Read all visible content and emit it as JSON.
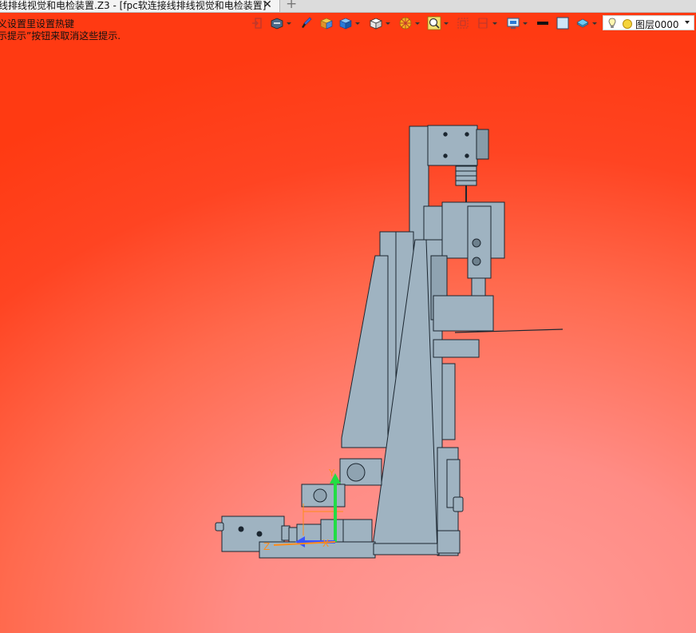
{
  "tab": {
    "title": "线排线视觉和电检装置.Z3 - [fpc软连接线排线视觉和电检装置]",
    "close_icon": "close-icon",
    "new_tab_icon": "plus-icon"
  },
  "hints": {
    "line1": "义设置里设置热键",
    "line2": "示提示”按钮来取消这些提示."
  },
  "toolbar": {
    "icons": [
      "exit-icon",
      "view-render-icon",
      "brush-icon",
      "box-render-icon",
      "cube-icon",
      "view-cube-icon",
      "filter-icon",
      "zoom-icon",
      "fit-view-icon",
      "section-icon",
      "display-icon",
      "line-color-icon",
      "fill-color-icon",
      "layer-stack-icon"
    ],
    "layer_label": "图层0000"
  },
  "viewport": {
    "axes": {
      "x": "X",
      "y": "Y",
      "z": "Z"
    },
    "colors": {
      "background_top": "#ff3a12",
      "background_bottom": "#ff9c98",
      "part_fill": "#9fb3c1",
      "part_stroke": "#1b2630",
      "axis_x": "#3a55ff",
      "axis_y": "#22dd44",
      "axis_z": "#ff8c1a"
    }
  }
}
